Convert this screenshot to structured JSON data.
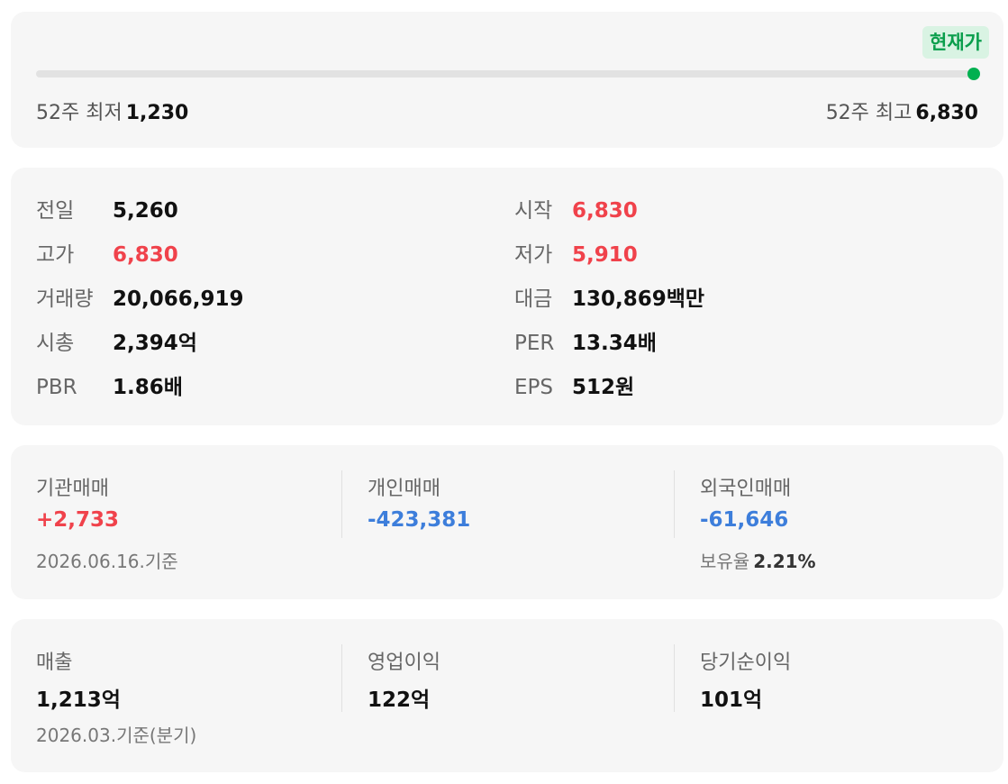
{
  "range": {
    "current_label": "현재가",
    "low_label": "52주 최저",
    "low_value": "1,230",
    "high_label": "52주 최고",
    "high_value": "6,830",
    "current_position_fraction": 1.0,
    "marker_color": "#00b050"
  },
  "stats": {
    "left": [
      {
        "label": "전일",
        "value": "5,260",
        "color": "default"
      },
      {
        "label": "고가",
        "value": "6,830",
        "color": "red"
      },
      {
        "label": "거래량",
        "value": "20,066,919",
        "color": "default"
      },
      {
        "label": "시총",
        "value": "2,394억",
        "color": "default"
      },
      {
        "label": "PBR",
        "value": "1.86배",
        "color": "default"
      }
    ],
    "right": [
      {
        "label": "시작",
        "value": "6,830",
        "color": "red"
      },
      {
        "label": "저가",
        "value": "5,910",
        "color": "red"
      },
      {
        "label": "대금",
        "value": "130,869백만",
        "color": "default"
      },
      {
        "label": "PER",
        "value": "13.34배",
        "color": "default"
      },
      {
        "label": "EPS",
        "value": "512원",
        "color": "default"
      }
    ]
  },
  "trading": {
    "institution": {
      "label": "기관매매",
      "value": "+2,733",
      "color": "red"
    },
    "individual": {
      "label": "개인매매",
      "value": "-423,381",
      "color": "blue"
    },
    "foreign": {
      "label": "외국인매매",
      "value": "-61,646",
      "color": "blue"
    },
    "date_note": "2026.06.16.기준",
    "holding_label": "보유율",
    "holding_value": "2.21%"
  },
  "financials": {
    "revenue": {
      "label": "매출",
      "value": "1,213억"
    },
    "operating_profit": {
      "label": "영업이익",
      "value": "122억"
    },
    "net_income": {
      "label": "당기순이익",
      "value": "101억"
    },
    "date_note": "2026.03.기준(분기)"
  },
  "colors": {
    "up": "#f0424b",
    "down": "#3d7edb",
    "accent": "#00b050",
    "card_bg": "#f6f6f6"
  }
}
